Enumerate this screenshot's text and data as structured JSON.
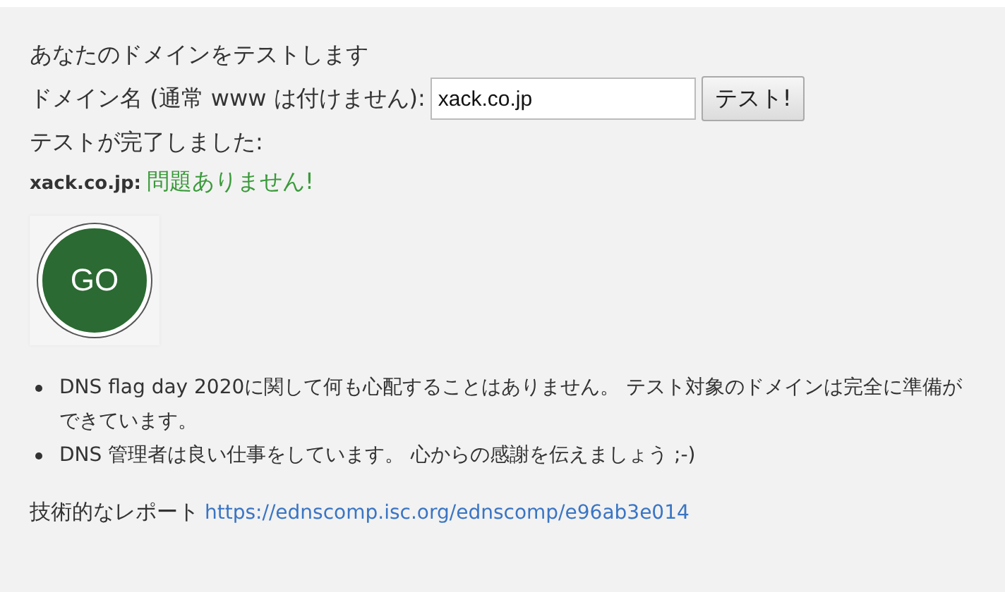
{
  "heading": "あなたのドメインをテストします",
  "domain_field": {
    "label": "ドメイン名 (通常 www は付けません):",
    "value": "xack.co.jp"
  },
  "test_button": "テスト!",
  "status": "テストが完了しました:",
  "result": {
    "domain": "xack.co.jp:",
    "message": "問題ありません!"
  },
  "badge": {
    "text": "GO",
    "color": "#2b6a32"
  },
  "bullets": [
    "DNS flag day 2020に関して何も心配することはありません。 テスト対象のドメインは完全に準備ができています。",
    "DNS 管理者は良い仕事をしています。 心からの感謝を伝えましょう ;-)"
  ],
  "report": {
    "label": "技術的なレポート",
    "link": "https://ednscomp.isc.org/ednscomp/e96ab3e014"
  }
}
